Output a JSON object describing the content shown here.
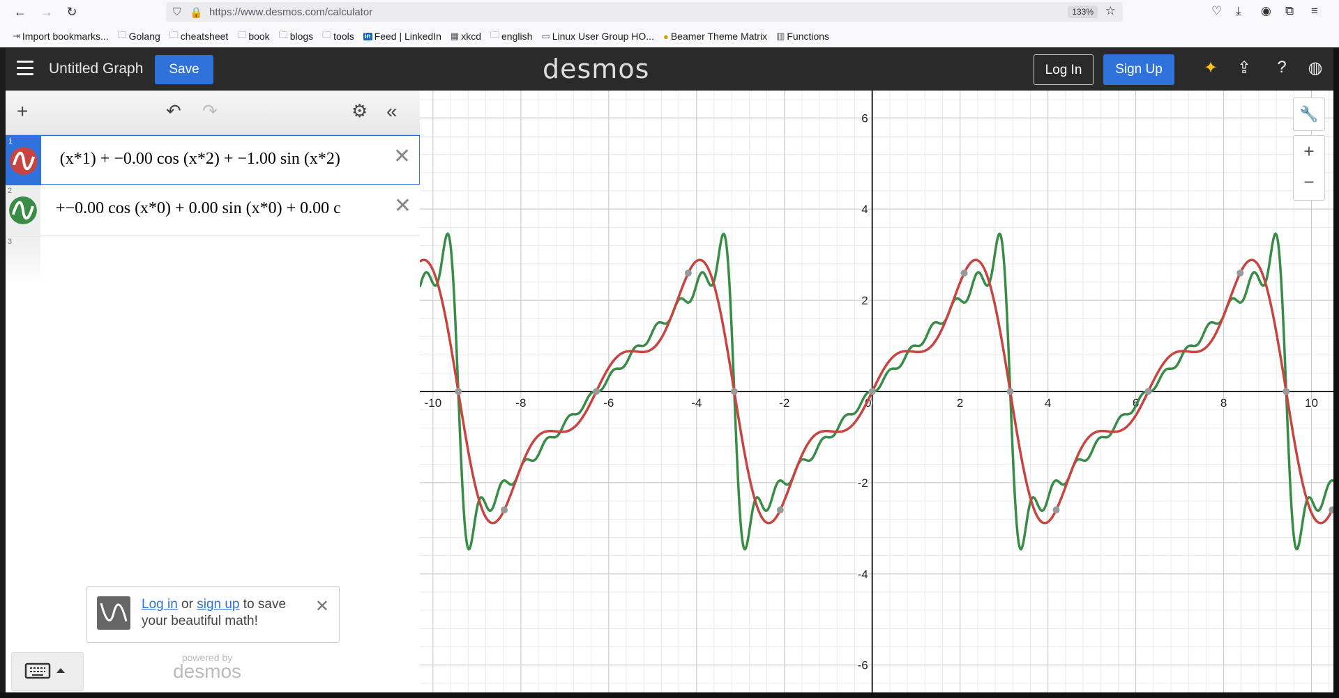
{
  "browser": {
    "url": "https://www.desmos.com/calculator",
    "zoom": "133%",
    "bookmarks": [
      {
        "label": "Import bookmarks...",
        "icon": "import-icon"
      },
      {
        "label": "Golang",
        "icon": "folder-icon"
      },
      {
        "label": "cheatsheet",
        "icon": "folder-icon"
      },
      {
        "label": "book",
        "icon": "folder-icon"
      },
      {
        "label": "blogs",
        "icon": "folder-icon"
      },
      {
        "label": "tools",
        "icon": "folder-icon"
      },
      {
        "label": "Feed | LinkedIn",
        "icon": "linkedin-icon"
      },
      {
        "label": "xkcd",
        "icon": "xkcd-icon"
      },
      {
        "label": "english",
        "icon": "folder-icon"
      },
      {
        "label": "Linux User Group HO...",
        "icon": "page-icon"
      },
      {
        "label": "Beamer Theme Matrix",
        "icon": "beamer-icon"
      },
      {
        "label": "Functions",
        "icon": "functions-icon"
      }
    ]
  },
  "header": {
    "title": "Untitled Graph",
    "save_label": "Save",
    "logo": "desmos",
    "login_label": "Log In",
    "signup_label": "Sign Up"
  },
  "expressions": [
    {
      "num": "1",
      "latex": " (x*1) + −0.00 cos (x*2) + −1.00 sin (x*2)",
      "color": "#c74440",
      "active": true
    },
    {
      "num": "2",
      "latex": "+−0.00 cos (x*0) + 0.00 sin (x*0) + 0.00 c",
      "color": "#388c46",
      "active": false
    },
    {
      "num": "3"
    }
  ],
  "toast": {
    "login_link": "Log in",
    "or_text": " or ",
    "signup_link": "sign up",
    "rest_text": " to save your beautiful math!"
  },
  "footer": {
    "powered_by": "powered by",
    "logo": "desmos"
  },
  "graph": {
    "x_ticks": [
      "-10",
      "-8",
      "-6",
      "-4",
      "-2",
      "0",
      "2",
      "4",
      "6",
      "8",
      "10"
    ],
    "y_ticks": [
      "6",
      "4",
      "2",
      "-2",
      "-4",
      "-6"
    ],
    "x_range": [
      -10.3,
      10.5
    ],
    "y_range": [
      -6.6,
      6.6
    ]
  }
}
